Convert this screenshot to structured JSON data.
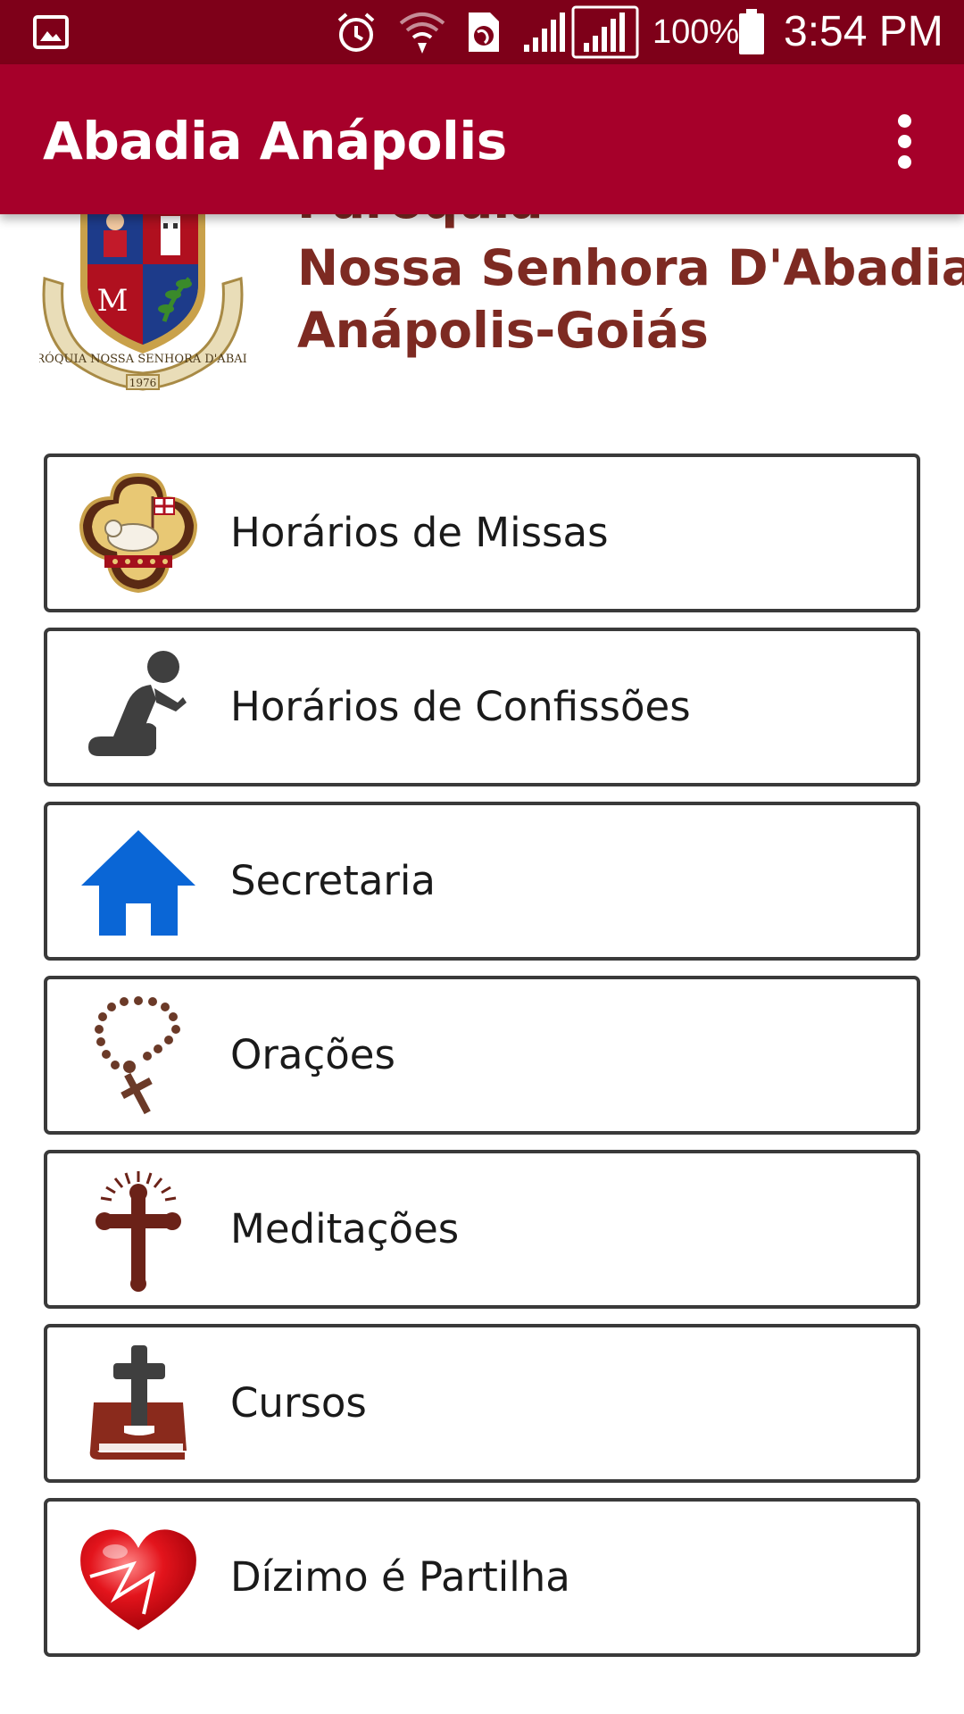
{
  "status_bar": {
    "battery_percent": "100%",
    "time": "3:54 PM",
    "icons": [
      "gallery-icon",
      "alarm-icon",
      "wifi-icon",
      "globe-icon",
      "signal-icon",
      "signal-icon",
      "battery-icon"
    ]
  },
  "app_bar": {
    "title": "Abadia Anápolis",
    "overflow_icon": "more-vert-icon"
  },
  "header": {
    "crest_icon": "parish-crest-icon",
    "line1": "Paróquia",
    "line2": "Nossa Senhora D'Abadia",
    "line3": "Anápolis-Goiás"
  },
  "menu": {
    "items": [
      {
        "label": "Horários de Missas",
        "icon": "lamb-of-god-icon"
      },
      {
        "label": "Horários de Confissões",
        "icon": "kneeling-person-icon"
      },
      {
        "label": "Secretaria",
        "icon": "home-icon"
      },
      {
        "label": "Orações",
        "icon": "rosary-icon"
      },
      {
        "label": "Meditações",
        "icon": "cross-icon"
      },
      {
        "label": "Cursos",
        "icon": "bible-icon"
      },
      {
        "label": "Dízimo é Partilha",
        "icon": "heart-icon"
      }
    ]
  },
  "colors": {
    "status_bar": "#7e0019",
    "app_bar": "#a6002a",
    "header_text": "#7d2a22",
    "home_icon": "#0a66d6",
    "icon_brown": "#6b3a28",
    "icon_dark": "#3f3f3f",
    "heart": "#e3141c"
  }
}
